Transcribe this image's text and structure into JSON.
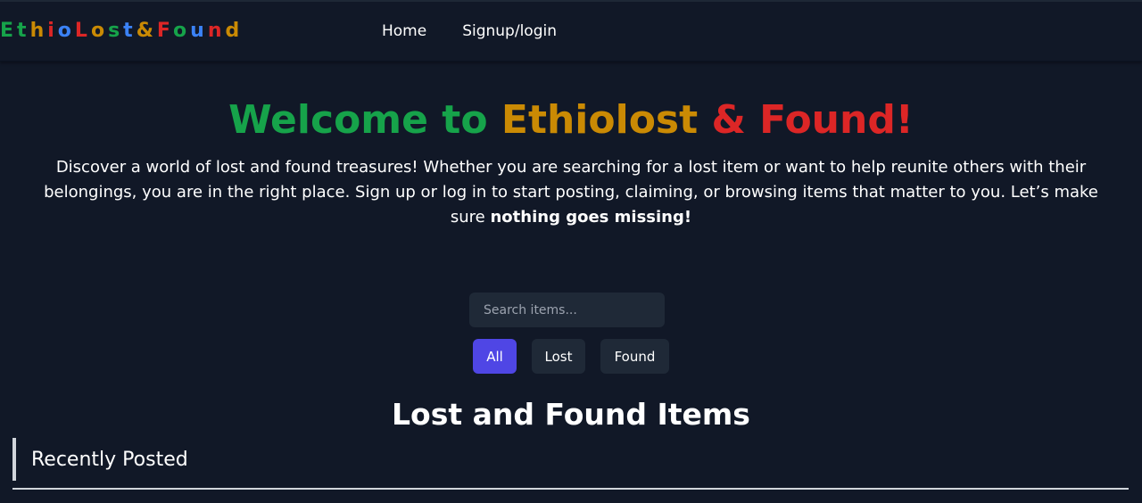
{
  "navbar": {
    "logo_letters": [
      {
        "char": "E",
        "color": "#16a34a"
      },
      {
        "char": "t",
        "color": "#16a34a"
      },
      {
        "char": "h",
        "color": "#ca8a04"
      },
      {
        "char": "i",
        "color": "#dc2626"
      },
      {
        "char": "o",
        "color": "#3b82f6"
      },
      {
        "char": "L",
        "color": "#dc2626"
      },
      {
        "char": "o",
        "color": "#ca8a04"
      },
      {
        "char": "s",
        "color": "#16a34a"
      },
      {
        "char": "t",
        "color": "#3b82f6"
      },
      {
        "char": "&",
        "color": "#ca8a04"
      },
      {
        "char": "F",
        "color": "#dc2626"
      },
      {
        "char": "o",
        "color": "#16a34a"
      },
      {
        "char": "u",
        "color": "#3b82f6"
      },
      {
        "char": "n",
        "color": "#dc2626"
      },
      {
        "char": "d",
        "color": "#ca8a04"
      }
    ],
    "links": {
      "home": "Home",
      "signup_login": "Signup/login"
    }
  },
  "hero": {
    "title_part1": "Welcome to ",
    "title_part2": "Ethiolost",
    "title_part3": " & Found!",
    "title_colors": {
      "part1": "#16a34a",
      "part2": "#ca8a04",
      "part3": "#dc2626"
    },
    "description": "Discover a world of lost and found treasures! Whether you are searching for a lost item or want to help reunite others with their belongings, you are in the right place. Sign up or log in to start posting, claiming, or browsing items that matter to you. Let’s make sure ",
    "description_bold": "nothing goes missing!"
  },
  "search": {
    "placeholder": "Search items...",
    "value": ""
  },
  "filters": {
    "all": "All",
    "lost": "Lost",
    "found": "Found",
    "active": "All",
    "active_color": "#4f46e5"
  },
  "items_section": {
    "title": "Lost and Found Items",
    "recent_label": "Recently Posted"
  }
}
